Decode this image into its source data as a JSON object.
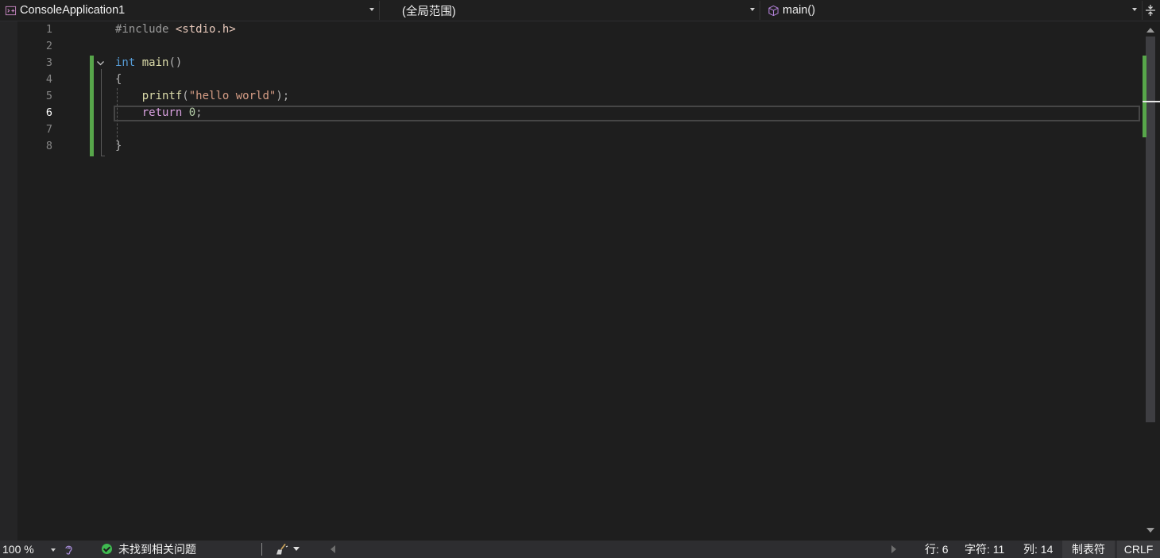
{
  "navbar": {
    "project_dropdown": "ConsoleApplication1",
    "scope_dropdown": "(全局范围)",
    "member_dropdown": "main()",
    "icons": [
      "project-icon",
      "cube-icon",
      "split-editor-icon"
    ]
  },
  "editor": {
    "line_numbers": [
      "1",
      "2",
      "3",
      "4",
      "5",
      "6",
      "7",
      "8"
    ],
    "current_line": "6",
    "lines": {
      "l1": {
        "directive": "#include",
        "header": "<stdio.h>"
      },
      "l3": {
        "type": "int",
        "name": "main",
        "parens": "()"
      },
      "l4": {
        "brace": "{"
      },
      "l5": {
        "call": "printf",
        "open": "(",
        "string": "\"hello world\"",
        "close": ");"
      },
      "l6": {
        "keyword": "return",
        "value": "0",
        "end": ";"
      },
      "l8": {
        "brace": "}"
      }
    }
  },
  "status": {
    "zoom": "100 %",
    "issues": "未找到相关问题",
    "line": "行: 6",
    "char": "字符: 11",
    "col": "列: 14",
    "tabs": "制表符",
    "eol": "CRLF"
  },
  "colors": {
    "background": "#1e1e1e",
    "keyword": "#569cd6",
    "function": "#dcdcaa",
    "string": "#d69d85",
    "control": "#d8a0df",
    "number": "#b5cea8",
    "change_marker": "#57a64a"
  }
}
